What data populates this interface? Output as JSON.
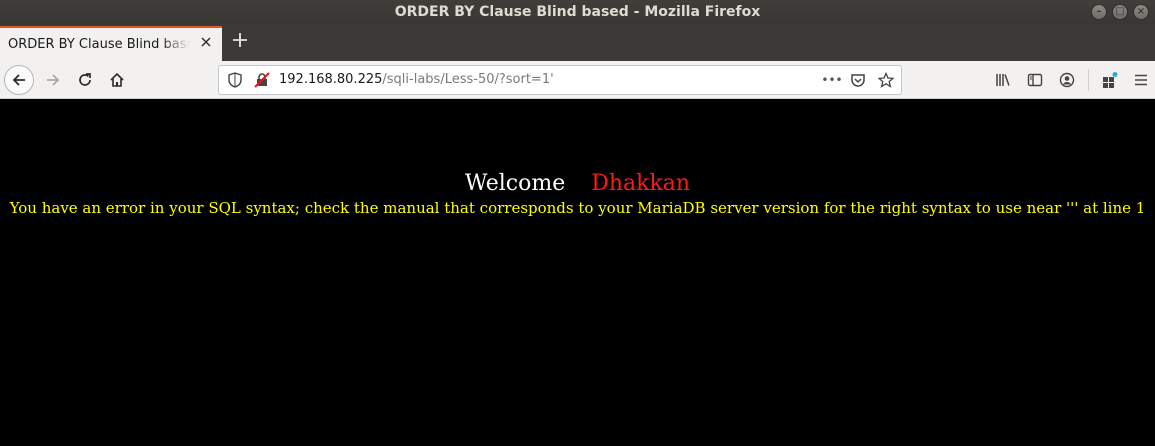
{
  "window": {
    "title": "ORDER BY Clause Blind based - Mozilla Firefox",
    "controls": [
      "minimize",
      "maximize",
      "close"
    ]
  },
  "tabs": [
    {
      "title": "ORDER BY Clause Blind based",
      "close_icon": "close-icon"
    }
  ],
  "new_tab_label": "+",
  "navbar": {
    "url_host": "192.168.80.225",
    "url_path": "/sqli-labs/Less-50/?sort=1'",
    "page_actions_label": "•••"
  },
  "page": {
    "welcome": "Welcome",
    "user_name": "Dhakkan",
    "error": "You have an error in your SQL syntax; check the manual that corresponds to your MariaDB server version for the right syntax to use near ''' at line 1"
  },
  "colors": {
    "background": "#000000",
    "welcome": "#ffffff",
    "user_name": "#ff1a1a",
    "error": "#ffff00",
    "tab_accent": "#e95420"
  }
}
